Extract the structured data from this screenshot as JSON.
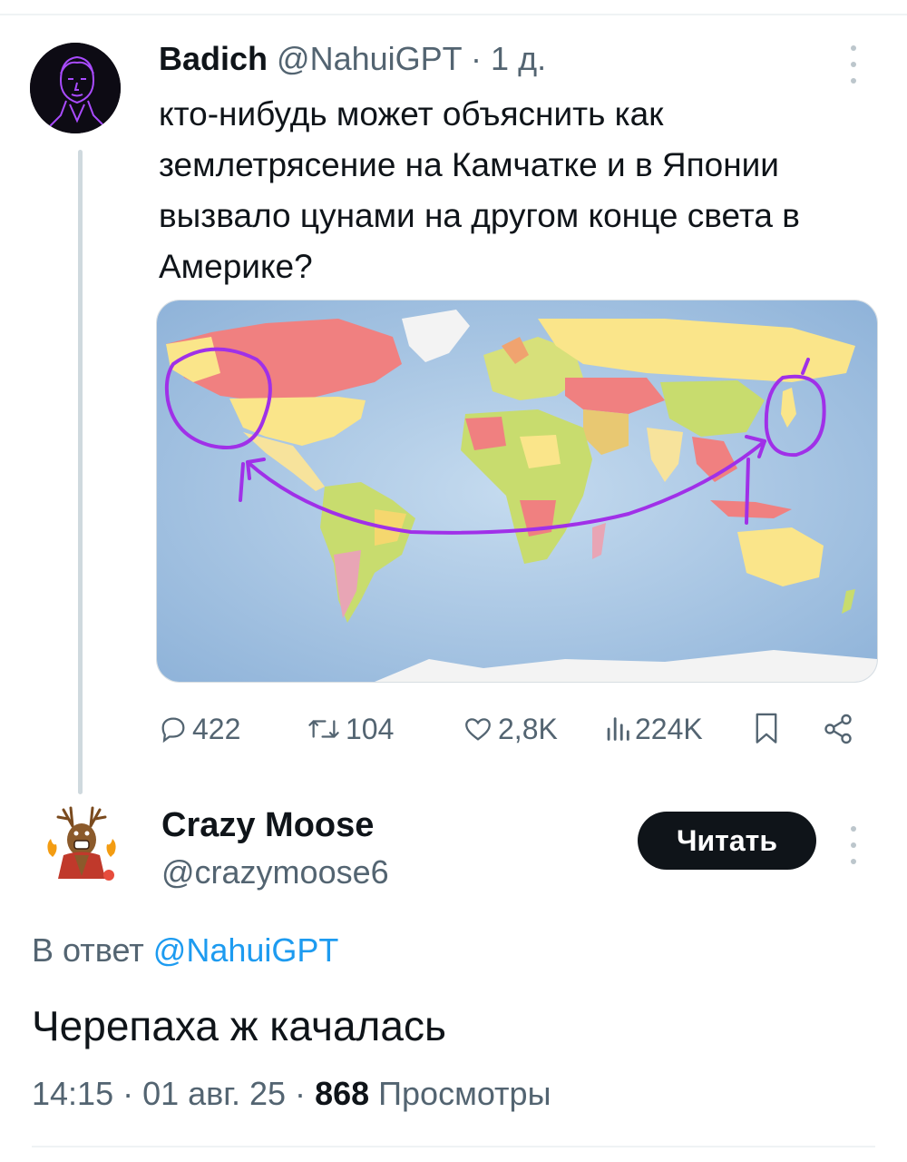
{
  "tweet": {
    "author_name": "Badich",
    "author_handle": "@NahuiGPT",
    "separator": "·",
    "time_ago": "1 д.",
    "text": "кто-нибудь может объяснить как землетрясение на Камчатке и в Японии вызвало цунами на другом конце света в Америке?",
    "stats": {
      "replies": "422",
      "reposts": "104",
      "likes": "2,8K",
      "views": "224K"
    },
    "icons": {
      "reply": "reply-icon",
      "repost": "repost-icon",
      "like": "heart-icon",
      "views": "bar-chart-icon",
      "bookmark": "bookmark-icon",
      "share": "share-icon"
    }
  },
  "reply": {
    "author_name": "Crazy Moose",
    "author_handle": "@crazymoose6",
    "follow_label": "Читать",
    "reply_prefix": "В ответ",
    "reply_mention": "@NahuiGPT",
    "text": "Черепаха ж качалась",
    "timestamp": "14:15 · 01 авг. 25 ·",
    "views_count": "868",
    "views_label": "Просмотры"
  },
  "colors": {
    "text": "#0f1419",
    "secondary": "#536471",
    "link": "#1d9bf0",
    "annotation": "#a030e8",
    "ocean": "#b3cde8"
  }
}
